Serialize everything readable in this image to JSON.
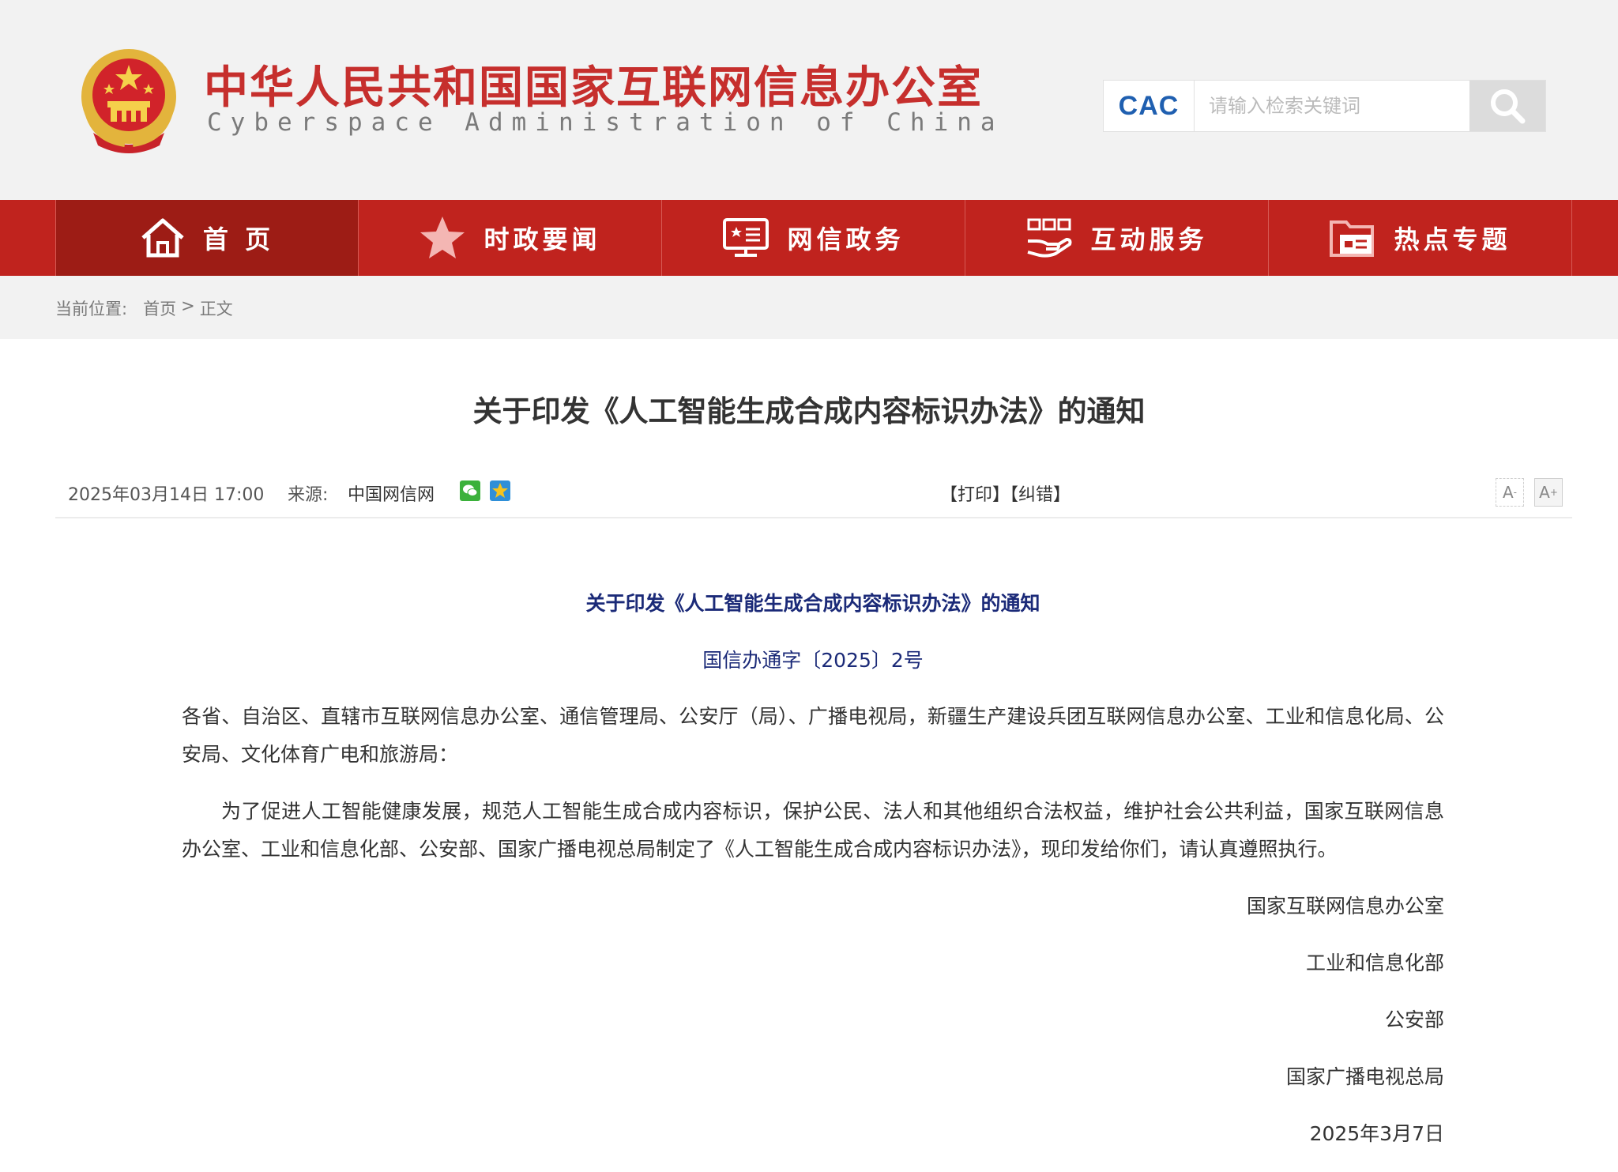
{
  "header": {
    "site_name_cn": "中华人民共和国国家互联网信息办公室",
    "site_name_en": "Cyberspace Administration of China",
    "search_logo": "CAC",
    "search_placeholder": "请输入检索关键词",
    "search_icon": "search-icon"
  },
  "nav": {
    "items": [
      {
        "label": "首 页",
        "icon": "home-icon"
      },
      {
        "label": "时政要闻",
        "icon": "star-icon"
      },
      {
        "label": "网信政务",
        "icon": "monitor-icon"
      },
      {
        "label": "互动服务",
        "icon": "hand-service-icon"
      },
      {
        "label": "热点专题",
        "icon": "folder-icon"
      }
    ]
  },
  "breadcrumb": {
    "label": "当前位置:",
    "home": "首页",
    "sep": ">",
    "current": "正文"
  },
  "article": {
    "title": "关于印发《人工智能生成合成内容标识办法》的通知",
    "date": "2025年03月14日 17:00",
    "source_label": "来源:",
    "source": "中国网信网",
    "print": "【打印】",
    "correct": "【纠错】",
    "font_small": "A",
    "font_big": "A",
    "doc_title": "关于印发《人工智能生成合成内容标识办法》的通知",
    "doc_no": "国信办通字〔2025〕2号",
    "recipients": "各省、自治区、直辖市互联网信息办公室、通信管理局、公安厅（局）、广播电视局，新疆生产建设兵团互联网信息办公室、工业和信息化局、公安局、文化体育广电和旅游局：",
    "body": "为了促进人工智能健康发展，规范人工智能生成合成内容标识，保护公民、法人和其他组织合法权益，维护社会公共利益，国家互联网信息办公室、工业和信息化部、公安部、国家广播电视总局制定了《人工智能生成合成内容标识办法》，现印发给你们，请认真遵照执行。",
    "signatures": [
      "国家互联网信息办公室",
      "工业和信息化部",
      "公安部",
      "国家广播电视总局"
    ],
    "sign_date": "2025年3月7日"
  },
  "colors": {
    "brand_red": "#c0231e",
    "nav_active": "#9d1c15",
    "doc_blue": "#1b2a78"
  }
}
